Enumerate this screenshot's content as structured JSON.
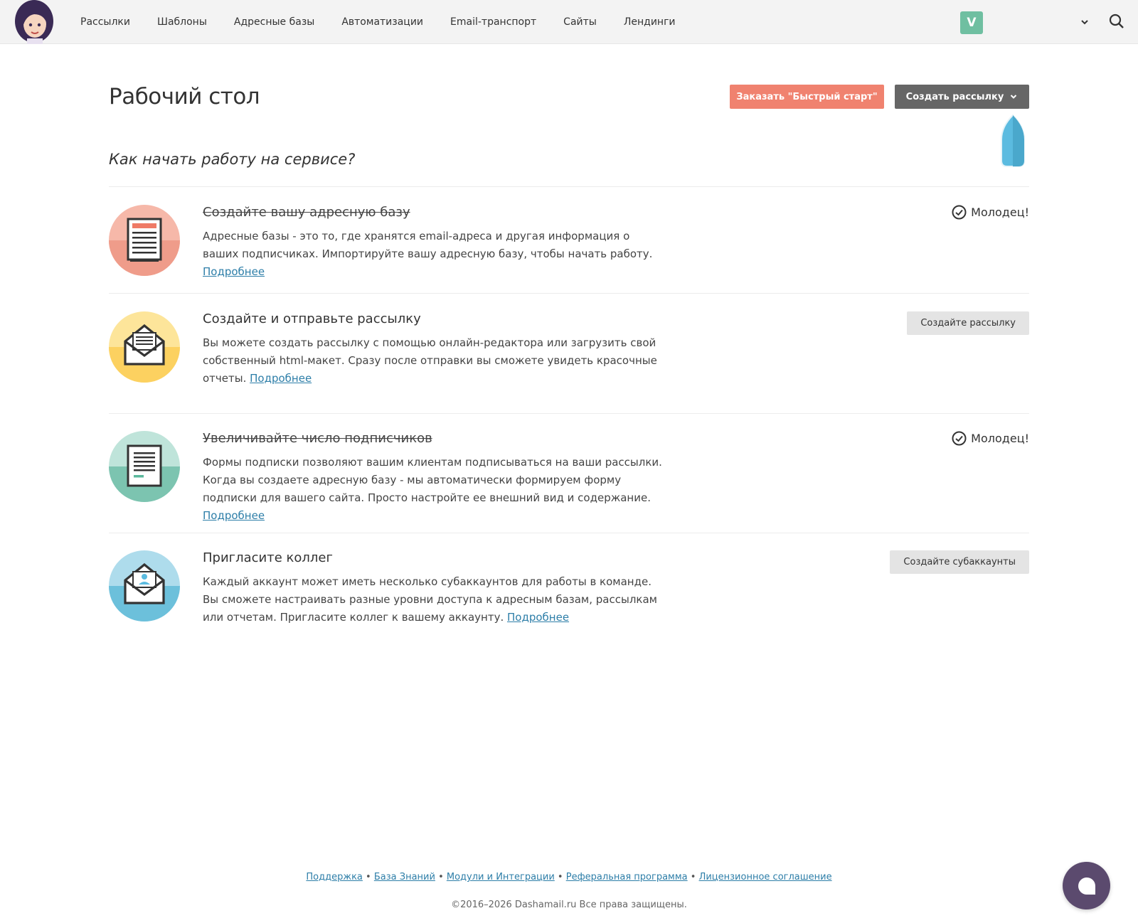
{
  "nav": {
    "items": [
      {
        "label": "Рассылки"
      },
      {
        "label": "Шаблоны"
      },
      {
        "label": "Адресные базы"
      },
      {
        "label": "Автоматизации"
      },
      {
        "label": "Email-транспорт"
      },
      {
        "label": "Сайты"
      },
      {
        "label": "Лендинги"
      }
    ],
    "account_badge": "V"
  },
  "header": {
    "title": "Рабочий стол",
    "quick_start_label": "Заказать \"Быстрый старт\"",
    "create_label": "Создать рассылку"
  },
  "subtitle": "Как начать работу на сервисе?",
  "steps": [
    {
      "title": "Создайте вашу адресную базу",
      "desc": "Адресные базы - это то, где хранятся email-адреса и другая информация о ваших подписчиках. Импортируйте вашу адресную базу, чтобы начать работу.",
      "link": "Подробнее",
      "status": "Молодец!",
      "icon": "address-book-icon",
      "colors": {
        "light": "#f6b8a9",
        "dark": "#ef9c8a"
      }
    },
    {
      "title": "Создайте и отправьте рассылку",
      "desc": "Вы можете создать рассылку с помощью онлайн-редактора или загрузить свой собственный html-макет. Сразу после отправки вы сможете увидеть красочные отчеты.",
      "link": "Подробнее",
      "button": "Создайте рассылку",
      "icon": "envelope-letter-icon",
      "colors": {
        "light": "#fde59a",
        "dark": "#fcd160"
      }
    },
    {
      "title": "Увеличивайте число подписчиков",
      "desc": "Формы подписки позволяют вашим клиентам подписываться на ваши рассылки. Когда вы создаете адресную базу - мы автоматически формируем форму подписки для вашего сайта. Просто настройте ее внешний вид и содержание.",
      "link": "Подробнее",
      "status": "Молодец!",
      "icon": "subscribe-form-icon",
      "colors": {
        "light": "#bfe4da",
        "dark": "#7cc4b0"
      }
    },
    {
      "title": "Пригласите коллег",
      "desc": "Каждый аккаунт может иметь несколько субаккаунтов для работы в команде. Вы сможете настраивать разные уровни доступа к адресным базам, рассылкам или отчетам. Пригласите коллег к вашему аккаунту.",
      "link": "Подробнее",
      "button": "Создайте субаккаунты",
      "icon": "invite-envelope-icon",
      "colors": {
        "light": "#aedcec",
        "dark": "#6cc0db"
      }
    }
  ],
  "footer": {
    "links": [
      "Поддержка",
      "База Знаний",
      "Модули и Интеграции",
      "Реферальная программа",
      "Лицензионное соглашение"
    ],
    "copyright": "©2016–2026 Dashamail.ru Все права защищены."
  },
  "colors": {
    "accent_orange": "#f0826f",
    "dark_button": "#666666",
    "link": "#2d7ea8",
    "badge_green": "#6fbfa1",
    "chat": "#5b4a6e"
  }
}
